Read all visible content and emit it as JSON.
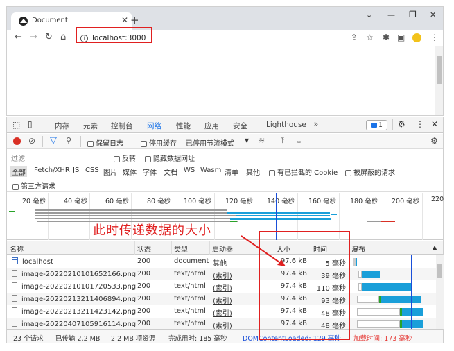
{
  "browser": {
    "tab_title": "Document",
    "url": "localhost:3000"
  },
  "devtools": {
    "tabs": [
      "内存",
      "元素",
      "控制台",
      "网络",
      "性能",
      "应用",
      "安全",
      "Lighthouse"
    ],
    "more": "»",
    "issues_count": "1",
    "network_toolbar": {
      "preserve_log": "保留日志",
      "disable_cache": "停用缓存",
      "throttle": "已停用节流模式"
    },
    "filter": {
      "placeholder": "过滤",
      "invert": "反转",
      "hide_data_urls": "隐藏数据网址"
    },
    "types": [
      "全部",
      "Fetch/XHR",
      "JS",
      "CSS",
      "图片",
      "媒体",
      "字体",
      "文档",
      "WS",
      "Wasm",
      "清单",
      "其他"
    ],
    "blocked_cookies": "有已拦截的 Cookie",
    "blocked_requests": "被屏蔽的请求",
    "third_party": "第三方请求",
    "timeline_ticks": [
      "20 毫秒",
      "40 毫秒",
      "60 毫秒",
      "80 毫秒",
      "100 毫秒",
      "120 毫秒",
      "140 毫秒",
      "160 毫秒",
      "180 毫秒",
      "200 毫秒",
      "220"
    ],
    "columns": {
      "name": "名称",
      "status": "状态",
      "type": "类型",
      "initiator": "启动器",
      "size": "大小",
      "time": "时间",
      "waterfall": "瀑布"
    },
    "rows": [
      {
        "name": "localhost",
        "status": "200",
        "type": "document",
        "initiator": "其他",
        "size": "97.6 kB",
        "time": "5 毫秒",
        "icon": "document-icon"
      },
      {
        "name": "image-20220210101652166.png",
        "status": "200",
        "type": "text/html",
        "initiator": "(索引)",
        "size": "97.4 kB",
        "time": "39 毫秒",
        "icon": "file-icon"
      },
      {
        "name": "image-20220210101720533.png",
        "status": "200",
        "type": "text/html",
        "initiator": "(索引)",
        "size": "97.4 kB",
        "time": "110 毫秒",
        "icon": "file-icon"
      },
      {
        "name": "image-20220213211406894.png",
        "status": "200",
        "type": "text/html",
        "initiator": "(索引)",
        "size": "97.4 kB",
        "time": "93 毫秒",
        "icon": "file-icon"
      },
      {
        "name": "image-20220213211423142.png",
        "status": "200",
        "type": "text/html",
        "initiator": "(索引)",
        "size": "97.4 kB",
        "time": "48 毫秒",
        "icon": "file-icon"
      },
      {
        "name": "image-20220407105916114.png",
        "status": "200",
        "type": "text/html",
        "initiator": "(索引)",
        "size": "97.4 kB",
        "time": "48 毫秒",
        "icon": "file-icon"
      }
    ],
    "status_bar": {
      "requests": "23 个请求",
      "transferred": "已传输 2.2 MB",
      "resources": "2.2 MB 项资源",
      "finish": "完成用时: 185 毫秒",
      "dcl": "DOMContentLoaded: 129 毫秒",
      "load": "加载时间: 173 毫秒"
    },
    "annotation": "此时传递数据的大小"
  },
  "colors": {
    "accent": "#1a73e8",
    "annotation_red": "#e02020",
    "waterfall_blue": "#1a9fd9",
    "waterfall_green": "#29a329",
    "dcl_blue": "#1a4fd9",
    "load_red": "#e53935"
  }
}
